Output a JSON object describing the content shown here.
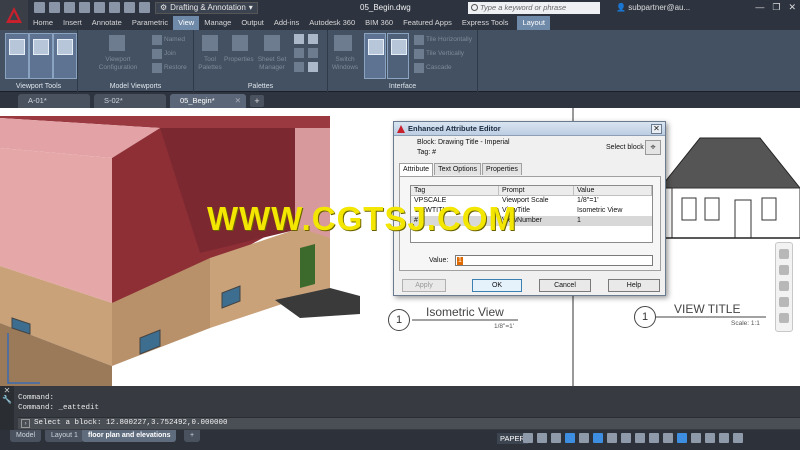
{
  "title_bar": {
    "workspace": "Drafting & Annotation",
    "document_title": "05_Begin.dwg",
    "search_placeholder": "Type a keyword or phrase",
    "user": "subpartner@au..."
  },
  "ribbon_tabs": [
    "Home",
    "Insert",
    "Annotate",
    "Parametric",
    "View",
    "Manage",
    "Output",
    "Add-ins",
    "Autodesk 360",
    "BIM 360",
    "Featured Apps",
    "Express Tools",
    "Layout"
  ],
  "ribbon_active_tab": "View",
  "ribbon": {
    "panels": {
      "viewport_tools": "Viewport Tools",
      "model_viewports": "Model Viewports",
      "palettes": "Palettes",
      "interface": "Interface"
    },
    "buttons": {
      "viewport_configuration": "Viewport Configuration",
      "named": "Named",
      "join": "Join",
      "restore": "Restore",
      "tool_palettes": "Tool Palettes",
      "properties": "Properties",
      "sheet_set_manager": "Sheet Set Manager",
      "switch_windows": "Switch Windows",
      "tile_horizontally": "Tile Horizontally",
      "tile_vertically": "Tile Vertically",
      "cascade": "Cascade"
    }
  },
  "doc_tabs": [
    {
      "label": "A-01*"
    },
    {
      "label": "S-02*"
    },
    {
      "label": "05_Begin*"
    }
  ],
  "drawing": {
    "left_view_title": "Isometric View",
    "left_view_number": "1",
    "left_view_scale": "1/8\"=1'",
    "right_view_title": "VIEW TITLE",
    "right_view_number": "1",
    "right_view_scale": "Scale: 1:1"
  },
  "dialog": {
    "title": "Enhanced Attribute Editor",
    "block": "Block: Drawing Title - Imperial",
    "tag": "Tag: #",
    "select_block": "Select block",
    "tabs": [
      "Attribute",
      "Text Options",
      "Properties"
    ],
    "columns": [
      "Tag",
      "Prompt",
      "Value"
    ],
    "rows": [
      [
        "VPSCALE",
        "Viewport Scale",
        "1/8\"=1'"
      ],
      [
        "VIEWTITLE",
        "ViewTitle",
        "Isometric View"
      ],
      [
        "#",
        "ViewNumber",
        "1"
      ]
    ],
    "value_label": "Value:",
    "value": "1",
    "buttons": {
      "apply": "Apply",
      "ok": "OK",
      "cancel": "Cancel",
      "help": "Help"
    }
  },
  "watermark": "WWW.CGTSJ.COM",
  "command": {
    "history": [
      "Command:",
      "Command:  _eattedit"
    ],
    "prompt": "Select a block: 12.800227,3.752492,0.000000"
  },
  "layout_tabs": [
    {
      "label": "Model"
    },
    {
      "label": "Layout 1"
    },
    {
      "label": "floor plan and elevations"
    }
  ],
  "status": {
    "paper": "PAPER"
  },
  "colors": {
    "roof": "#8e2f36",
    "roof_light": "#e3a3a6",
    "wall": "#c9a27a",
    "ribbon": "#435162",
    "accent": "#6f8aa8"
  }
}
